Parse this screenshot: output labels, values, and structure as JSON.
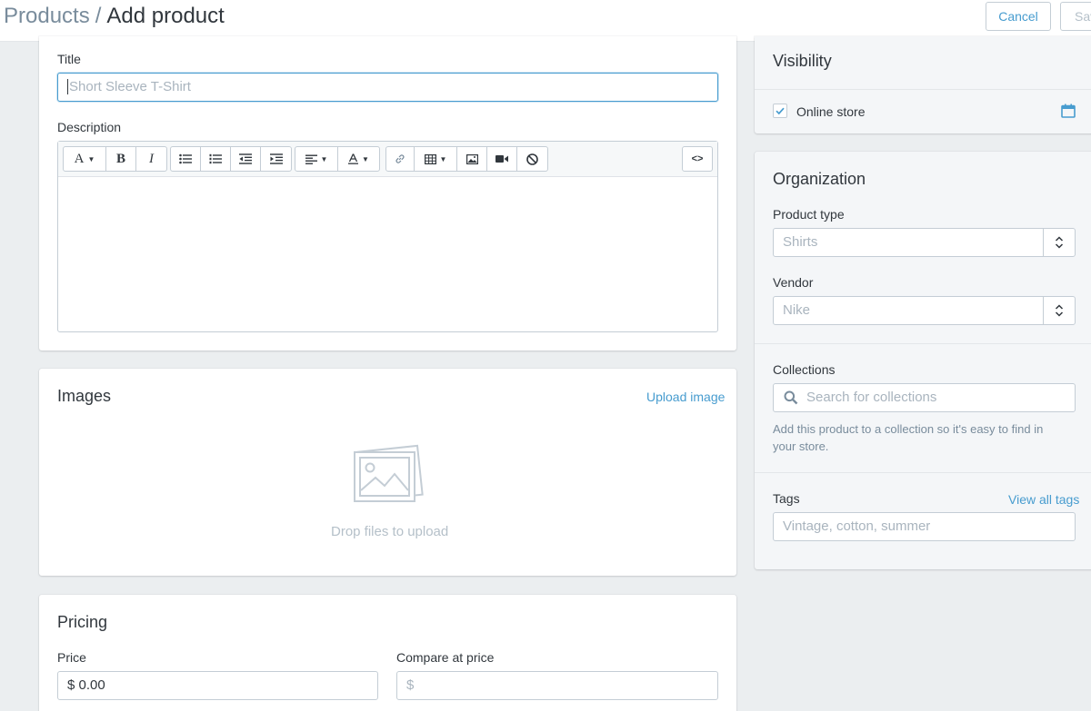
{
  "header": {
    "breadcrumb_parent": "Products",
    "breadcrumb_separator": "/",
    "breadcrumb_current": "Add product",
    "cancel_label": "Cancel",
    "save_label": "Save"
  },
  "product": {
    "title_label": "Title",
    "title_placeholder": "Short Sleeve T-Shirt",
    "description_label": "Description",
    "toolbar": {
      "font_letter": "A",
      "bold_letter": "B",
      "italic_letter": "I",
      "html_toggle": "<>"
    }
  },
  "images": {
    "title": "Images",
    "upload_link": "Upload image",
    "drop_text": "Drop files to upload"
  },
  "pricing": {
    "title": "Pricing",
    "price_label": "Price",
    "price_value": "$ 0.00",
    "compare_label": "Compare at price",
    "compare_placeholder": "$"
  },
  "visibility": {
    "title": "Visibility",
    "online_store_label": "Online store",
    "online_store_checked": true
  },
  "organization": {
    "title": "Organization",
    "product_type_label": "Product type",
    "product_type_placeholder": "Shirts",
    "vendor_label": "Vendor",
    "vendor_placeholder": "Nike",
    "collections_label": "Collections",
    "collections_placeholder": "Search for collections",
    "collections_help": "Add this product to a collection so it's easy to find in your store.",
    "tags_label": "Tags",
    "view_all_tags": "View all tags",
    "tags_placeholder": "Vintage, cotton, summer"
  },
  "colors": {
    "accent": "#479ccf",
    "page_background": "#ebeef0",
    "text": "#31373d",
    "muted": "#798c9c"
  }
}
